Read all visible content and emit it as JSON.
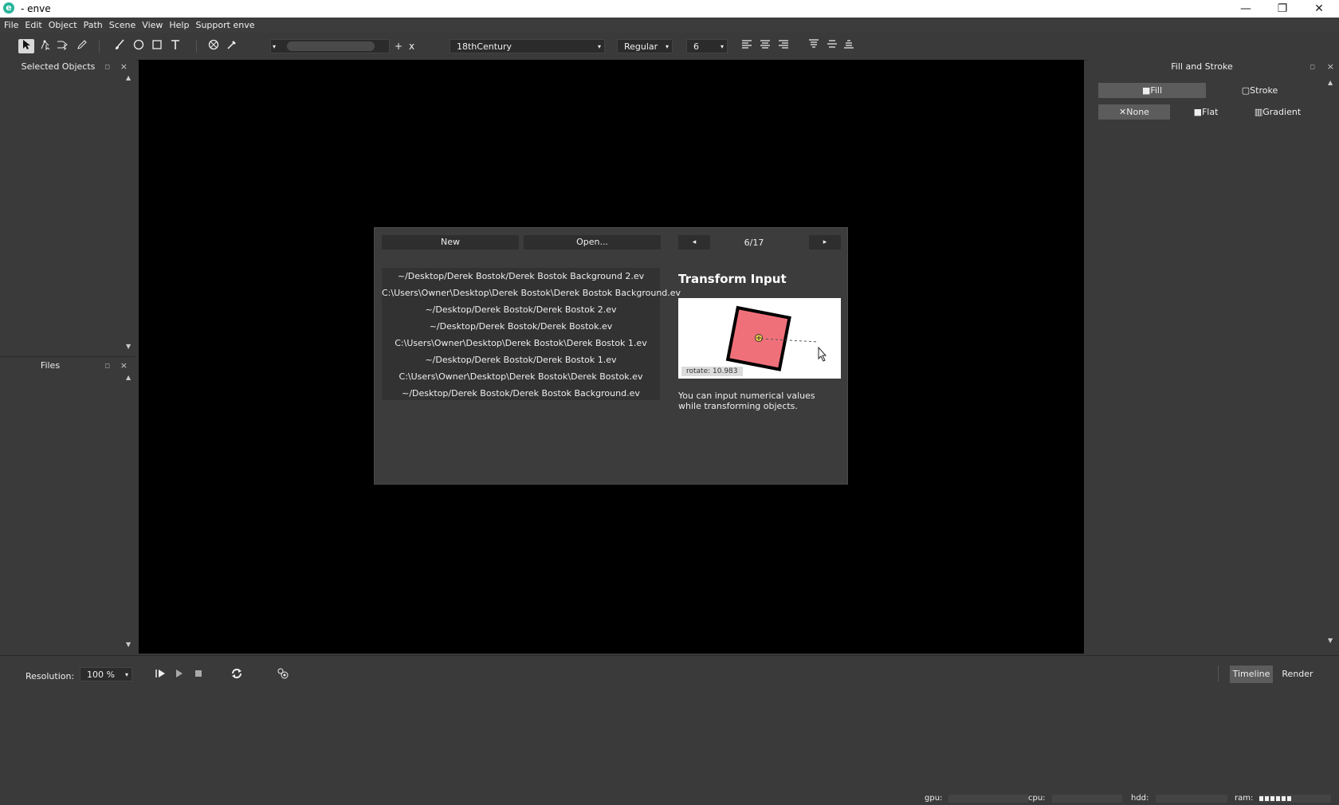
{
  "window": {
    "title": "- enve",
    "logo": "e",
    "minimize": "—",
    "maximize": "❐",
    "close": "✕"
  },
  "menu": [
    "File",
    "Edit",
    "Object",
    "Path",
    "Scene",
    "View",
    "Help",
    "Support enve"
  ],
  "toolbar": {
    "icons": [
      "select-arrow-icon",
      "node-select-icon",
      "path-point-icon",
      "pencil-icon",
      "brush-icon",
      "circle-tool-icon",
      "rectangle-tool-icon",
      "text-tool-icon",
      "null-object-icon",
      "color-picker-icon"
    ],
    "add_label": "+",
    "remove_label": "x",
    "font_family": "18thCentury",
    "font_style": "Regular",
    "font_size": "6"
  },
  "left_panel": {
    "selected_objects_title": "Selected Objects",
    "files_title": "Files"
  },
  "dialog": {
    "new_label": "New",
    "open_label": "Open...",
    "prev": "◂",
    "next": "▸",
    "page": "6/17",
    "recent_files": [
      "~/Desktop/Derek Bostok/Derek Bostok Background 2.ev",
      "C:\\Users\\Owner\\Desktop\\Derek Bostok\\Derek Bostok Background.ev",
      "~/Desktop/Derek Bostok/Derek Bostok 2.ev",
      "~/Desktop/Derek Bostok/Derek Bostok.ev",
      "C:\\Users\\Owner\\Desktop\\Derek Bostok\\Derek Bostok 1.ev",
      "~/Desktop/Derek Bostok/Derek Bostok 1.ev",
      "C:\\Users\\Owner\\Desktop\\Derek Bostok\\Derek Bostok.ev",
      "~/Desktop/Derek Bostok/Derek Bostok Background.ev"
    ],
    "tip_title": "Transform Input",
    "tip_caption": "rotate: 10.983",
    "tip_text": "You can input numerical values while transforming objects."
  },
  "right_panel": {
    "title": "Fill and Stroke",
    "tabs": [
      "Fill",
      "Stroke"
    ],
    "paint_types": [
      "None",
      "Flat",
      "Gradient"
    ]
  },
  "bottom": {
    "resolution_label": "Resolution:",
    "resolution_value": "100 %",
    "timeline_label": "Timeline",
    "render_label": "Render"
  },
  "status": {
    "gpu": "gpu:",
    "cpu": "cpu:",
    "hdd": "hdd:",
    "ram": "ram:"
  },
  "colors": {
    "accent_tip_square": "#f0707a",
    "canvas": "#000000"
  }
}
